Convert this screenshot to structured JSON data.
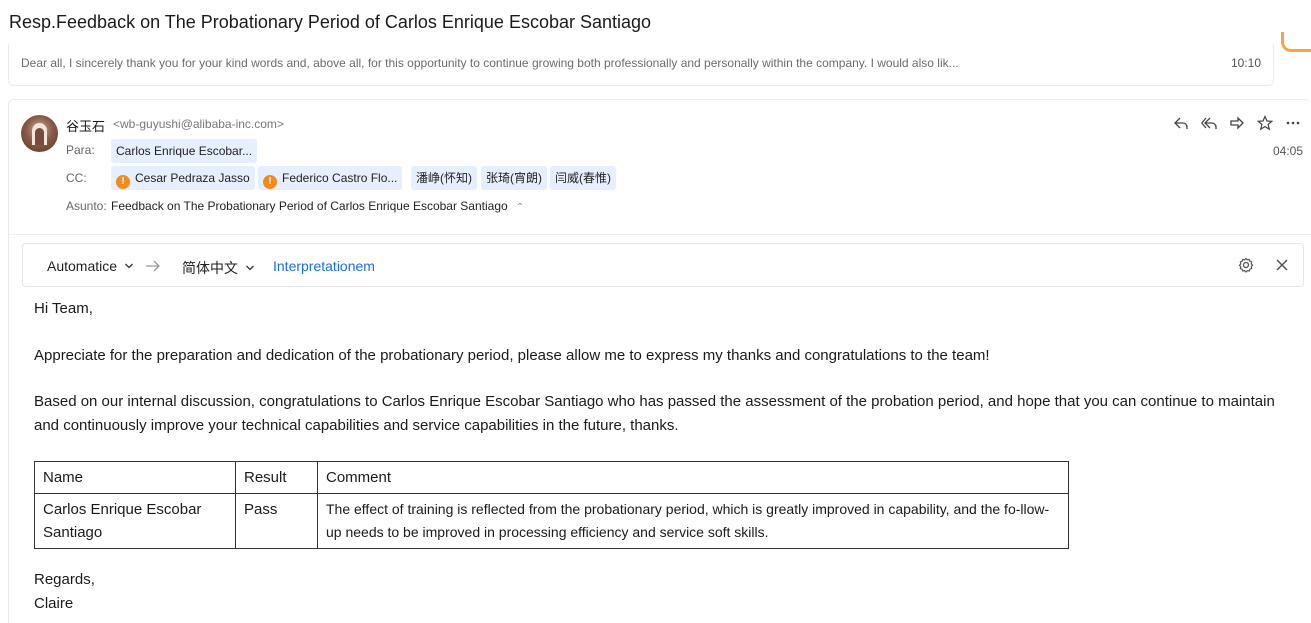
{
  "thread": {
    "subject": "Resp.Feedback on The Probationary Period of Carlos Enrique Escobar Santiago"
  },
  "previous_message": {
    "snippet": "Dear all, I sincerely thank you for your kind words and, above all, for this opportunity to continue growing both professionally and personally within the company. I would also lik...",
    "time": "10:10"
  },
  "message": {
    "sender_name": "谷玉石",
    "sender_email": "<wb-guyushi@alibaba-inc.com>",
    "to_label": "Para:",
    "to": [
      "Carlos Enrique Escobar..."
    ],
    "cc_label": "CC:",
    "cc": [
      {
        "name": "Cesar Pedraza Jasso",
        "warning": true
      },
      {
        "name": "Federico Castro Flo...",
        "warning": true
      },
      {
        "name": "潘峥(怀知)",
        "warning": false
      },
      {
        "name": "张琦(宵朗)",
        "warning": false
      },
      {
        "name": "闫威(春惟)",
        "warning": false
      }
    ],
    "subject_label": "Asunto:",
    "subject": "Feedback on The Probationary Period of Carlos Enrique Escobar Santiago",
    "time": "04:05",
    "actions": [
      "reply-icon",
      "reply-all-icon",
      "forward-icon",
      "star-icon",
      "more-icon"
    ]
  },
  "translation_bar": {
    "source_lang": "Automatice",
    "target_lang": "简体中文",
    "link": "Interpretationem"
  },
  "body": {
    "greeting": "Hi Team,",
    "para1": "Appreciate for the preparation and dedication of the probationary period, please allow me to express my thanks and congratulations to the team!",
    "para2": "Based on our internal discussion, congratulations to Carlos Enrique Escobar Santiago who has passed the assessment of the probation period, and hope that you can continue to maintain and continuously improve your technical capabilities and service capabilities in the future, thanks.",
    "table": {
      "headers": [
        "Name",
        "Result",
        "Comment"
      ],
      "rows": [
        [
          "Carlos Enrique Escobar Santiago",
          "Pass",
          "The effect of training is reflected from the probationary period, which is greatly improved in capability, and the fo-llow-up needs to be improved in processing efficiency and service soft skills."
        ]
      ]
    },
    "closing": "Regards,",
    "signature": "Claire"
  },
  "colors": {
    "accent": "#1b6fe0",
    "chip_bg": "#e5efff",
    "warning": "#f28b1e",
    "orange_corner": "#f7a541"
  }
}
